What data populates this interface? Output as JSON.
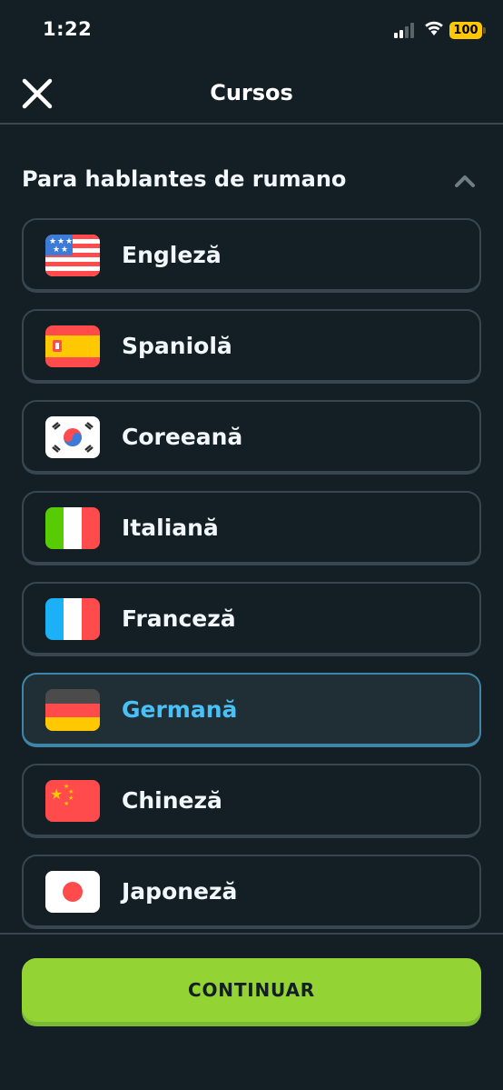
{
  "status_bar": {
    "time": "1:22",
    "battery": "100"
  },
  "header": {
    "title": "Cursos"
  },
  "section": {
    "title": "Para hablantes de rumano"
  },
  "courses": [
    {
      "name": "Engleză",
      "flag": "usa-flag-icon",
      "selected": false
    },
    {
      "name": "Spaniolă",
      "flag": "spain-flag-icon",
      "selected": false
    },
    {
      "name": "Coreeană",
      "flag": "south-korea-flag-icon",
      "selected": false
    },
    {
      "name": "Italiană",
      "flag": "italy-flag-icon",
      "selected": false
    },
    {
      "name": "Franceză",
      "flag": "france-flag-icon",
      "selected": false
    },
    {
      "name": "Germană",
      "flag": "germany-flag-icon",
      "selected": true
    },
    {
      "name": "Chineză",
      "flag": "china-flag-icon",
      "selected": false
    },
    {
      "name": "Japoneză",
      "flag": "japan-flag-icon",
      "selected": false
    }
  ],
  "footer": {
    "continue_label": "CONTINUAR"
  },
  "colors": {
    "background": "#131f24",
    "border": "#37464f",
    "selected_border": "#3f85a7",
    "selected_text": "#49c0f8",
    "continue_button": "#93d333",
    "battery": "#ffc800"
  }
}
